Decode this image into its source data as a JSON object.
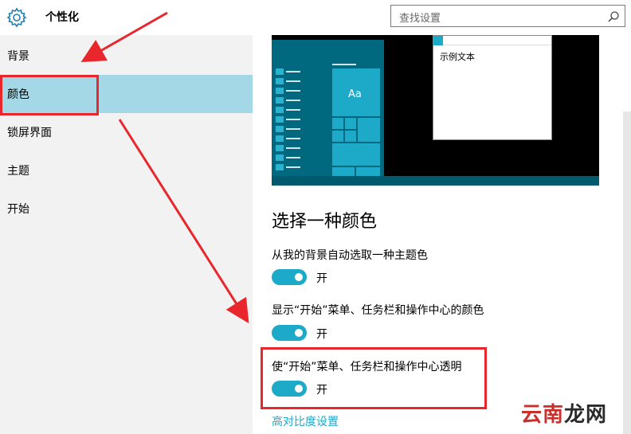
{
  "header": {
    "title": "个性化",
    "search_placeholder": "查找设置"
  },
  "sidebar": {
    "items": [
      {
        "label": "背景"
      },
      {
        "label": "颜色"
      },
      {
        "label": "锁屏界面"
      },
      {
        "label": "主题"
      },
      {
        "label": "开始"
      }
    ],
    "selected_index": 1
  },
  "preview": {
    "tile_label": "Aa",
    "sample_text": "示例文本"
  },
  "main": {
    "section_title": "选择一种颜色",
    "settings": [
      {
        "label": "从我的背景自动选取一种主题色",
        "state": "开"
      },
      {
        "label": "显示“开始”菜单、任务栏和操作中心的颜色",
        "state": "开"
      },
      {
        "label": "使“开始”菜单、任务栏和操作中心透明",
        "state": "开"
      }
    ],
    "contrast_link": "高对比度设置"
  },
  "watermark": {
    "part1": "云南",
    "part2": "龙网"
  },
  "colors": {
    "accent": "#1da9c8",
    "sidebar_bg": "#f2f2f2",
    "selected_bg": "#a5d8e6",
    "annotation": "#e8262b"
  }
}
